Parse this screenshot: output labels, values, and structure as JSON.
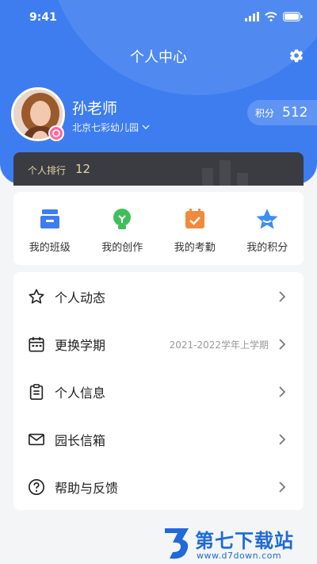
{
  "status_bar": {
    "time": "9:41"
  },
  "header": {
    "title": "个人中心"
  },
  "profile": {
    "name": "孙老师",
    "school": "北京七彩幼儿园",
    "points_label": "积分",
    "points_value": "512"
  },
  "rank": {
    "label": "个人排行",
    "value": "12"
  },
  "quick_actions": [
    {
      "label": "我的班级",
      "icon": "class-icon",
      "color": "#3d7df0"
    },
    {
      "label": "我的创作",
      "icon": "creation-icon",
      "color": "#3fbf5a"
    },
    {
      "label": "我的考勤",
      "icon": "attendance-icon",
      "color": "#f08a3d"
    },
    {
      "label": "我的积分",
      "icon": "points-star-icon",
      "color": "#3d8ff0"
    }
  ],
  "menu": [
    {
      "label": "个人动态",
      "value": "",
      "icon": "star-outline-icon"
    },
    {
      "label": "更换学期",
      "value": "2021-2022学年上学期",
      "icon": "calendar-icon"
    },
    {
      "label": "个人信息",
      "value": "",
      "icon": "clipboard-icon"
    },
    {
      "label": "园长信箱",
      "value": "",
      "icon": "mail-icon"
    },
    {
      "label": "帮助与反馈",
      "value": "",
      "icon": "help-icon"
    }
  ],
  "watermark": {
    "text": "第七下载站",
    "url": "www.d7down.com"
  },
  "colors": {
    "primary": "#3d7df0",
    "rank_bg": "#3a3c42",
    "rank_text": "#e6d3a5"
  }
}
